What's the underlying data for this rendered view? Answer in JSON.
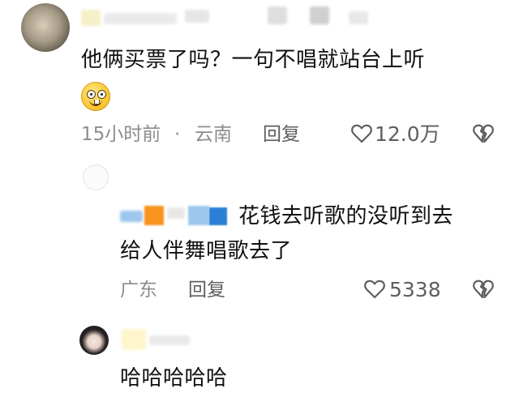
{
  "comments": [
    {
      "text": "他俩买票了吗？一句不唱就站台上听",
      "time": "15小时前",
      "separator": "·",
      "location": "云南",
      "reply_label": "回复",
      "like_count": "12.0万",
      "icons": [
        "smiley-emoji-icon",
        "heart-outline-icon",
        "broken-heart-icon"
      ]
    },
    {
      "text_line1": "花钱去听歌的没听到去",
      "text_line2": "给人伴舞唱歌去了",
      "location": "广东",
      "reply_label": "回复",
      "like_count": "5338",
      "icons": [
        "heart-outline-icon",
        "broken-heart-icon"
      ]
    },
    {
      "text": "哈哈哈哈哈"
    }
  ],
  "colors": {
    "text": "#111111",
    "meta": "#8d8d8d",
    "action": "#5e5e5e",
    "blur_orange": "#f7931e",
    "blur_blue": "#2c7fd6",
    "blur_lightblue": "#9cc7ee"
  }
}
